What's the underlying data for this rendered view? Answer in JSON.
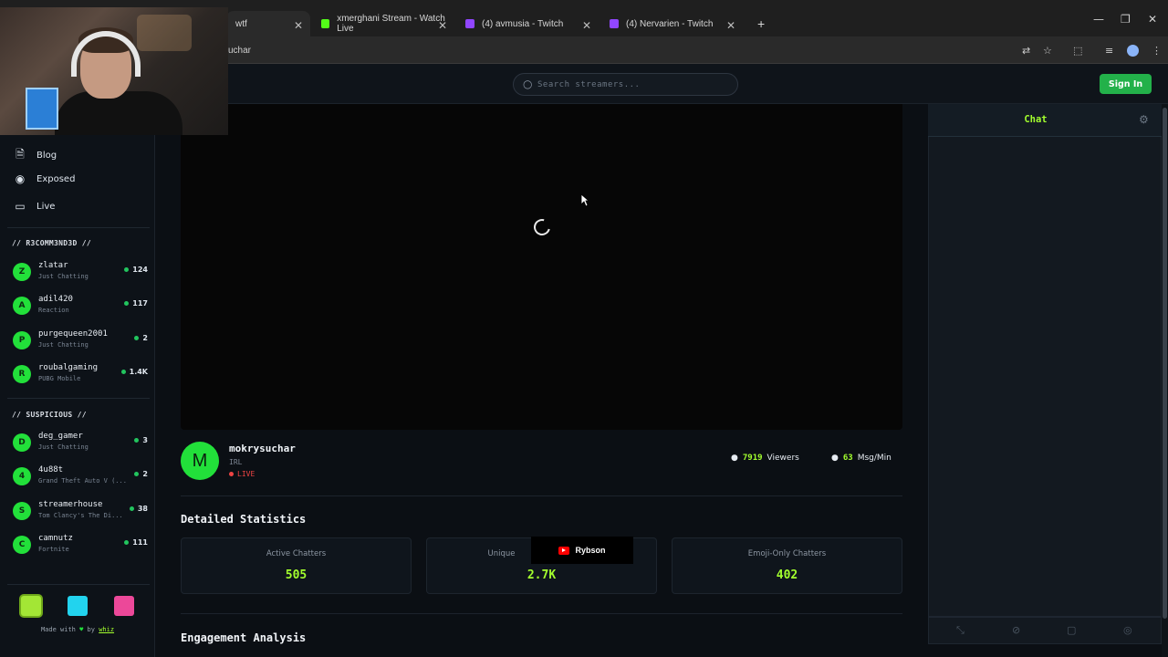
{
  "browser": {
    "tabs": [
      {
        "label": "wtf",
        "color": "#bfbfbf"
      },
      {
        "label": "xmerghani Stream - Watch Live",
        "color": "#53fc18"
      },
      {
        "label": "(4) avmusia - Twitch",
        "color": "#9146ff"
      },
      {
        "label": "(4) Nervarien - Twitch",
        "color": "#9146ff"
      }
    ],
    "new_tab": "+",
    "address": "uchar",
    "window_controls": {
      "minimize": "—",
      "restore": "❐",
      "close": "✕"
    }
  },
  "header": {
    "search_placeholder": "Search streamers...",
    "sign_in": "Sign In"
  },
  "sidebar": {
    "nav": [
      {
        "label": "Blog",
        "icon": "document-icon"
      },
      {
        "label": "Exposed",
        "icon": "eye-icon"
      },
      {
        "label": "Live",
        "icon": "tv-icon"
      }
    ],
    "recommended_title": "// R3COMM3ND3D //",
    "recommended": [
      {
        "initial": "Z",
        "name": "zlatar",
        "game": "Just Chatting",
        "viewers": "124"
      },
      {
        "initial": "A",
        "name": "adil420",
        "game": "Reaction",
        "viewers": "117"
      },
      {
        "initial": "P",
        "name": "purgequeen2001",
        "game": "Just Chatting",
        "viewers": "2"
      },
      {
        "initial": "R",
        "name": "roubalgaming",
        "game": "PUBG Mobile",
        "viewers": "1.4K"
      }
    ],
    "suspicious_title": "// SUSPICIOUS //",
    "suspicious": [
      {
        "initial": "D",
        "name": "deg_gamer",
        "game": "Just Chatting",
        "viewers": "3"
      },
      {
        "initial": "4",
        "name": "4u88t",
        "game": "Grand Theft Auto V (...",
        "viewers": "2"
      },
      {
        "initial": "S",
        "name": "streamerhouse",
        "game": "Tom Clancy's The Di...",
        "viewers": "38"
      },
      {
        "initial": "C",
        "name": "camnutz",
        "game": "Fortnite",
        "viewers": "111"
      }
    ],
    "theme_colors": [
      "#a3e635",
      "#22d3ee",
      "#ec4899"
    ],
    "credit_prefix": "Made with",
    "credit_by": "by",
    "credit_author": "whiz"
  },
  "channel": {
    "initial": "M",
    "name": "mokrysuchar",
    "category": "IRL",
    "status": "LIVE",
    "viewers": "7919",
    "viewers_label": "Viewers",
    "msg_rate": "63",
    "msg_rate_label": "Msg/Min"
  },
  "stats": {
    "title": "Detailed Statistics",
    "cards": [
      {
        "label": "Active Chatters",
        "value": "505"
      },
      {
        "label": "Unique",
        "value": "2.7K"
      },
      {
        "label": "Emoji-Only Chatters",
        "value": "402"
      }
    ],
    "overlay_label": "Rybson"
  },
  "engagement": {
    "title": "Engagement Analysis"
  },
  "chat": {
    "title": "Chat"
  },
  "colors": {
    "accent": "#a3ff2e",
    "brand_green": "#22e03a",
    "live": "#ef4444"
  }
}
